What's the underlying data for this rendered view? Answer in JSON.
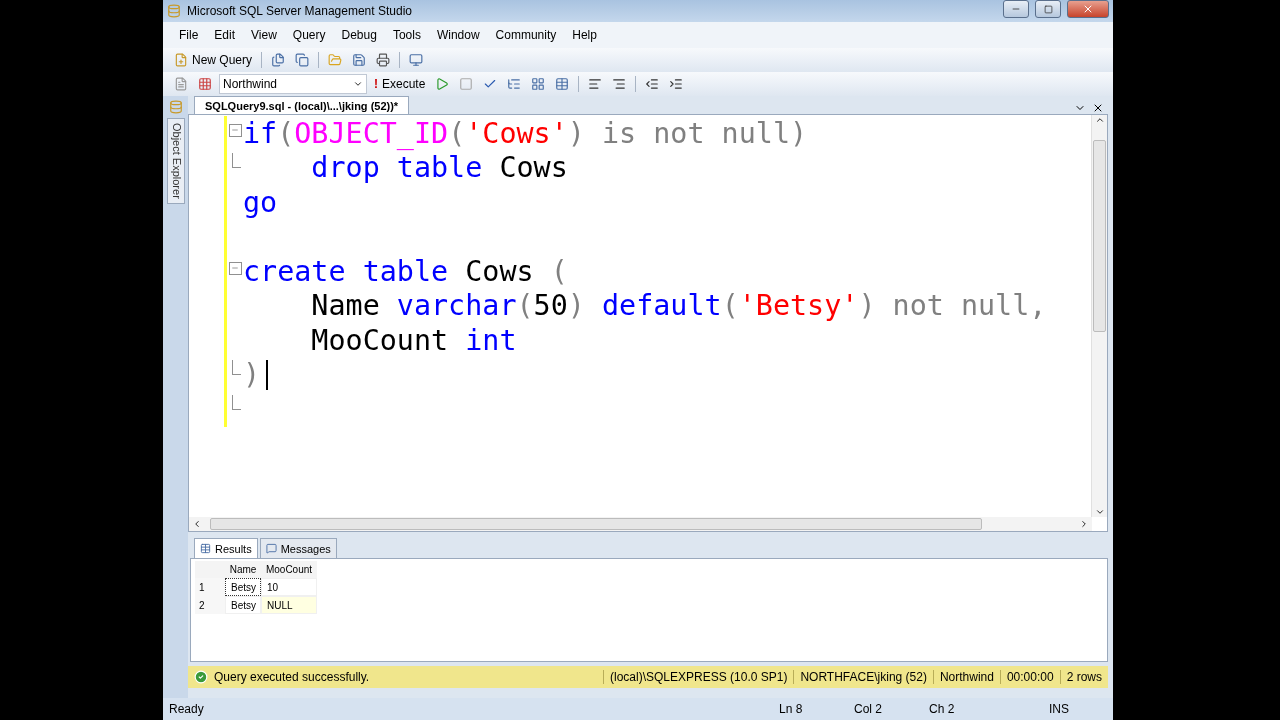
{
  "window": {
    "title": "Microsoft SQL Server Management Studio"
  },
  "menu": [
    "File",
    "Edit",
    "View",
    "Query",
    "Debug",
    "Tools",
    "Window",
    "Community",
    "Help"
  ],
  "toolbar": {
    "new_query": "New Query"
  },
  "query_toolbar": {
    "database": "Northwind",
    "execute_mark": "!",
    "execute": "Execute"
  },
  "side_tab": "Object Explorer",
  "document_tab": {
    "title": "SQLQuery9.sql - (local)\\...\\jking (52))*",
    "selected": true
  },
  "editor": {
    "lines": [
      {
        "kind": "fold-start",
        "changed": true,
        "cursor": false,
        "tokens": [
          {
            "kind": "keyword",
            "text": "if"
          },
          {
            "kind": "operator",
            "text": "("
          },
          {
            "kind": "function",
            "text": "OBJECT_ID"
          },
          {
            "kind": "operator",
            "text": "("
          },
          {
            "kind": "string",
            "text": "'Cows'"
          },
          {
            "kind": "operator",
            "text": ") is not null)"
          }
        ]
      },
      {
        "kind": "fold-end",
        "changed": true,
        "cursor": false,
        "tokens": [
          {
            "kind": "keyword",
            "text": "    drop table"
          },
          {
            "kind": "plain",
            "text": " Cows"
          }
        ]
      },
      {
        "kind": "plain",
        "changed": true,
        "cursor": false,
        "tokens": [
          {
            "kind": "keyword",
            "text": "go"
          }
        ]
      },
      {
        "kind": "plain",
        "changed": true,
        "cursor": false
      },
      {
        "kind": "fold-start",
        "changed": true,
        "cursor": false,
        "tokens": [
          {
            "kind": "keyword",
            "text": "create table"
          },
          {
            "kind": "plain",
            "text": " Cows "
          },
          {
            "kind": "operator",
            "text": "("
          }
        ]
      },
      {
        "kind": "plain",
        "changed": true,
        "cursor": false,
        "tokens": [
          {
            "kind": "plain",
            "text": "    Name "
          },
          {
            "kind": "keyword",
            "text": "varchar"
          },
          {
            "kind": "operator",
            "text": "("
          },
          {
            "kind": "plain",
            "text": "50"
          },
          {
            "kind": "operator",
            "text": ") "
          },
          {
            "kind": "keyword",
            "text": "default"
          },
          {
            "kind": "operator",
            "text": "("
          },
          {
            "kind": "string",
            "text": "'Betsy'"
          },
          {
            "kind": "operator",
            "text": ") not null,"
          }
        ]
      },
      {
        "kind": "plain",
        "changed": true,
        "cursor": false,
        "tokens": [
          {
            "kind": "plain",
            "text": "    MooCount "
          },
          {
            "kind": "keyword",
            "text": "int"
          }
        ]
      },
      {
        "kind": "fold-end",
        "changed": true,
        "cursor": true,
        "tokens": [
          {
            "kind": "operator",
            "text": ")"
          }
        ]
      },
      {
        "kind": "fold-end",
        "changed": true,
        "cursor": false
      }
    ]
  },
  "results_tabs": [
    {
      "label": "Results",
      "selected": true
    },
    {
      "label": "Messages",
      "selected": false
    }
  ],
  "grid": {
    "columns": [
      "Name",
      "MooCount"
    ],
    "rows": [
      {
        "number": "1",
        "cells": [
          {
            "text": "Betsy",
            "selected": true,
            "kind": "value"
          },
          {
            "text": "10",
            "selected": false,
            "kind": "value"
          }
        ]
      },
      {
        "number": "2",
        "cells": [
          {
            "text": "Betsy",
            "selected": false,
            "kind": "value"
          },
          {
            "text": "NULL",
            "selected": false,
            "kind": "null"
          }
        ]
      }
    ]
  },
  "query_status": {
    "message": "Query executed successfully.",
    "segments": [
      "(local)\\SQLEXPRESS (10.0 SP1)",
      "NORTHFACE\\jking (52)",
      "Northwind",
      "00:00:00",
      "2 rows"
    ]
  },
  "status_bar": {
    "state": "Ready",
    "line": "Ln 8",
    "column": "Col 2",
    "char": "Ch 2",
    "mode": "INS"
  }
}
